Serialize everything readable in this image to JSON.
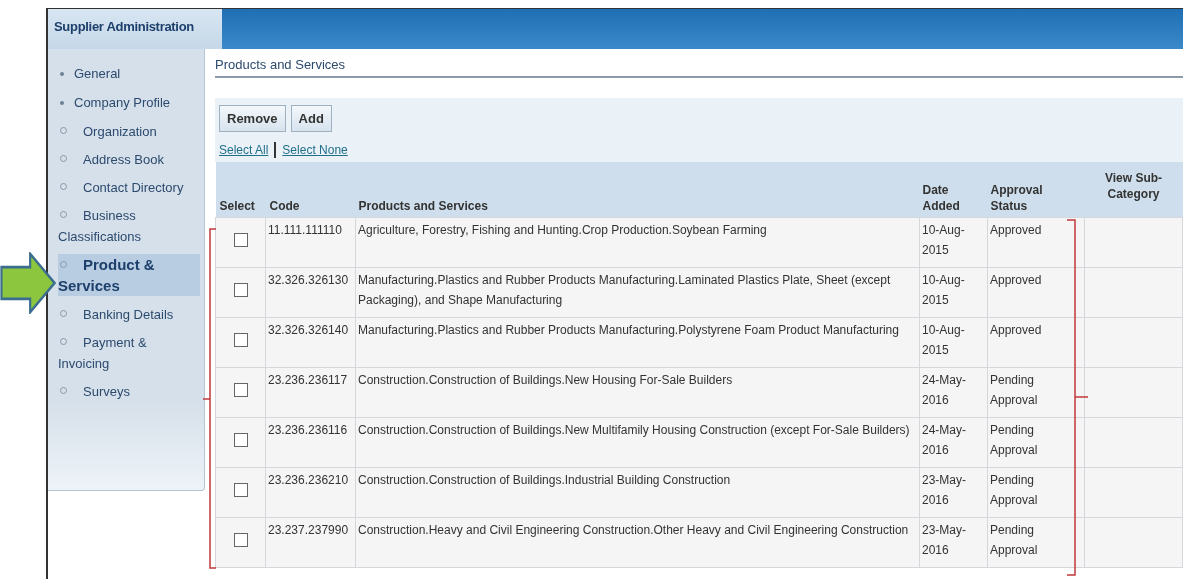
{
  "header": {
    "tab": "Supplier Administration"
  },
  "sidebar": {
    "items": [
      {
        "label": "General",
        "selected": false
      },
      {
        "label": "Company Profile",
        "selected": false,
        "children": [
          {
            "label": "Organization",
            "selected": false
          },
          {
            "label": "Address Book",
            "selected": false
          },
          {
            "label": "Contact Directory",
            "selected": false
          },
          {
            "label": "Business Classifications",
            "selected": false
          },
          {
            "label": "Product & Services",
            "selected": true
          },
          {
            "label": "Banking Details",
            "selected": false
          },
          {
            "label": "Payment & Invoicing",
            "selected": false
          },
          {
            "label": "Surveys",
            "selected": false
          }
        ]
      }
    ]
  },
  "section_title": "Products and Services",
  "buttons": [
    "Remove",
    "Add"
  ],
  "links": [
    "Select All",
    "Select None"
  ],
  "table": {
    "columns": [
      "Select",
      "Code",
      "Products and Services",
      "Date Added",
      "Approval Status",
      "View Sub-Category"
    ],
    "rows": [
      {
        "checked": false,
        "code": "11.111.111110",
        "name": "Agriculture, Forestry, Fishing and Hunting.Crop Production.Soybean Farming",
        "date": "10-Aug-2015",
        "status": "Approved"
      },
      {
        "checked": false,
        "code": "32.326.326130",
        "name": "Manufacturing.Plastics and Rubber Products Manufacturing.Laminated Plastics Plate, Sheet (except Packaging), and Shape Manufacturing",
        "date": "10-Aug-2015",
        "status": "Approved"
      },
      {
        "checked": false,
        "code": "32.326.326140",
        "name": "Manufacturing.Plastics and Rubber Products Manufacturing.Polystyrene Foam Product Manufacturing",
        "date": "10-Aug-2015",
        "status": "Approved"
      },
      {
        "checked": false,
        "code": "23.236.236117",
        "name": "Construction.Construction of Buildings.New Housing For-Sale Builders",
        "date": "24-May-2016",
        "status": "Pending Approval"
      },
      {
        "checked": false,
        "code": "23.236.236116",
        "name": "Construction.Construction of Buildings.New Multifamily Housing Construction (except For-Sale Builders)",
        "date": "24-May-2016",
        "status": "Pending Approval"
      },
      {
        "checked": false,
        "code": "23.236.236210",
        "name": "Construction.Construction of Buildings.Industrial Building Construction",
        "date": "23-May-2016",
        "status": "Pending Approval"
      },
      {
        "checked": false,
        "code": "23.237.237990",
        "name": "Construction.Heavy and Civil Engineering Construction.Other Heavy and Civil Engineering Construction",
        "date": "23-May-2016",
        "status": "Pending Approval"
      }
    ]
  }
}
